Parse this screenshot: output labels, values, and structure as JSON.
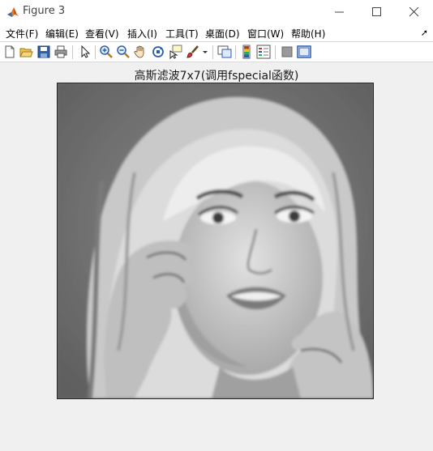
{
  "window": {
    "title": "Figure 3",
    "controls": [
      "minimize-icon",
      "maximize-icon",
      "close-icon"
    ],
    "accent": "#e87722"
  },
  "menu": {
    "items": [
      "文件(F)",
      "编辑(E)",
      "查看(V)",
      "插入(I)",
      "工具(T)",
      "桌面(D)",
      "窗口(W)",
      "帮助(H)"
    ]
  },
  "toolbar": {
    "icons": [
      "new-figure-icon",
      "open-file-icon",
      "save-icon",
      "print-icon",
      "edit-plot-arrow-icon",
      "zoom-in-icon",
      "zoom-out-icon",
      "pan-hand-icon",
      "rotate-3d-icon",
      "data-cursor-icon",
      "brush-icon",
      "brush-dropdown-icon",
      "link-plot-icon",
      "insert-colorbar-icon",
      "insert-legend-icon",
      "hide-plot-tools-icon",
      "show-plot-tools-icon"
    ]
  },
  "axes": {
    "title": "高斯滤波7x7(调用fspecial函数)",
    "image": "grayscale-portrait-blurred"
  }
}
